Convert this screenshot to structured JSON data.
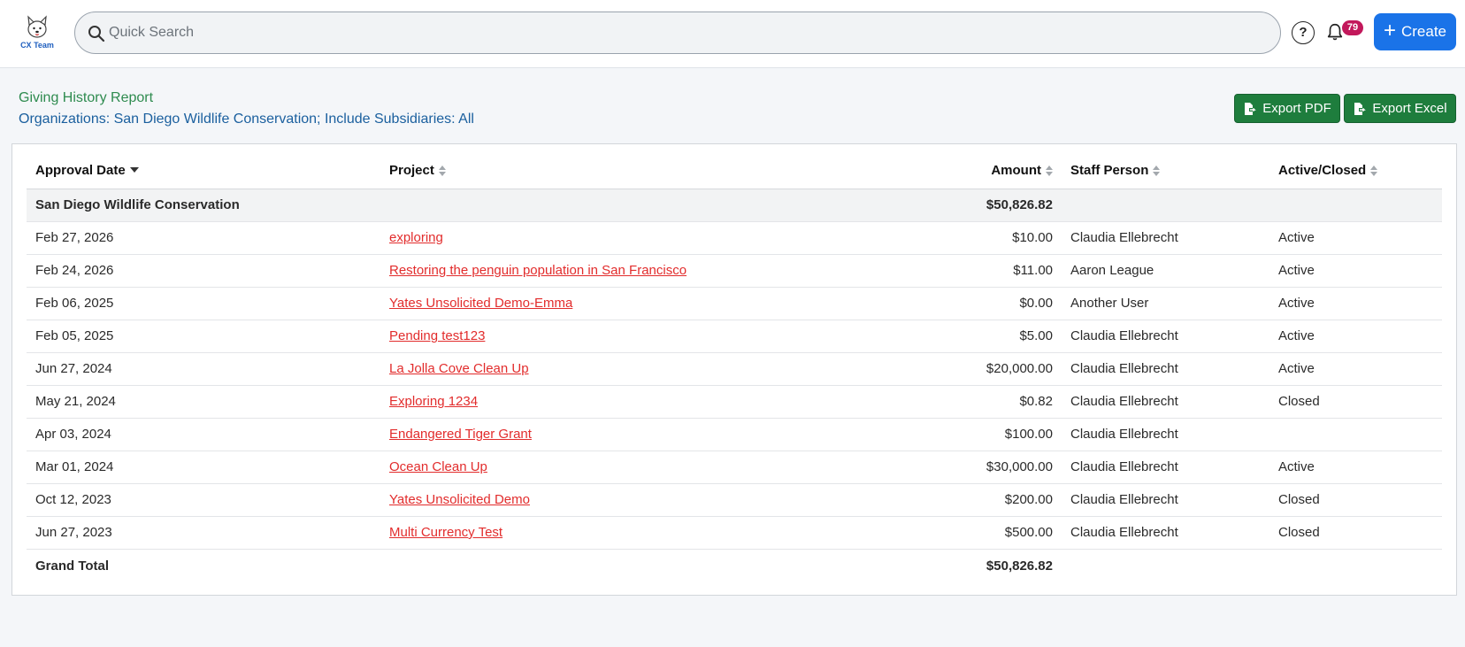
{
  "header": {
    "logo_text": "CX Team",
    "search_placeholder": "Quick Search",
    "help_label": "?",
    "notification_count": "79",
    "create_label": "Create"
  },
  "report": {
    "title": "Giving History Report",
    "subtitle": "Organizations: San Diego Wildlife Conservation; Include Subsidiaries: All",
    "export_pdf_label": "Export PDF",
    "export_excel_label": "Export Excel"
  },
  "table": {
    "columns": [
      "Approval Date",
      "Project",
      "Amount",
      "Staff Person",
      "Active/Closed"
    ],
    "group": {
      "name": "San Diego Wildlife Conservation",
      "amount": "$50,826.82"
    },
    "rows": [
      {
        "date": "Feb 27, 2026",
        "project": "exploring",
        "amount": "$10.00",
        "staff": "Claudia Ellebrecht",
        "status": "Active"
      },
      {
        "date": "Feb 24, 2026",
        "project": "Restoring the penguin population in San Francisco",
        "amount": "$11.00",
        "staff": "Aaron League",
        "status": "Active"
      },
      {
        "date": "Feb 06, 2025",
        "project": "Yates Unsolicited Demo-Emma",
        "amount": "$0.00",
        "staff": "Another User",
        "status": "Active"
      },
      {
        "date": "Feb 05, 2025",
        "project": "Pending test123",
        "amount": "$5.00",
        "staff": "Claudia Ellebrecht",
        "status": "Active"
      },
      {
        "date": "Jun 27, 2024",
        "project": "La Jolla Cove Clean Up",
        "amount": "$20,000.00",
        "staff": "Claudia Ellebrecht",
        "status": "Active"
      },
      {
        "date": "May 21, 2024",
        "project": "Exploring 1234",
        "amount": "$0.82",
        "staff": "Claudia Ellebrecht",
        "status": "Closed"
      },
      {
        "date": "Apr 03, 2024",
        "project": "Endangered Tiger Grant",
        "amount": "$100.00",
        "staff": "Claudia Ellebrecht",
        "status": ""
      },
      {
        "date": "Mar 01, 2024",
        "project": "Ocean Clean Up",
        "amount": "$30,000.00",
        "staff": "Claudia Ellebrecht",
        "status": "Active"
      },
      {
        "date": "Oct 12, 2023",
        "project": "Yates Unsolicited Demo",
        "amount": "$200.00",
        "staff": "Claudia Ellebrecht",
        "status": "Closed"
      },
      {
        "date": "Jun 27, 2023",
        "project": "Multi Currency Test",
        "amount": "$500.00",
        "staff": "Claudia Ellebrecht",
        "status": "Closed"
      }
    ],
    "grand_total_label": "Grand Total",
    "grand_total_amount": "$50,826.82"
  },
  "colors": {
    "primary": "#1a73e8",
    "export_green": "#1e7d3d",
    "title_green": "#2e8b4f",
    "subtitle_blue": "#1a5f9e",
    "link_red": "#e22c2c",
    "badge": "#c2185b"
  },
  "icons": [
    "app-logo",
    "search-icon",
    "help-icon",
    "bell-icon",
    "plus-icon",
    "file-export-icon",
    "sort-icon",
    "sort-desc-icon"
  ]
}
